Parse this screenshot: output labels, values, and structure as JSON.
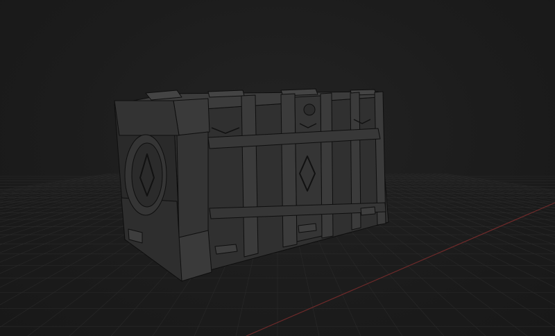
{
  "viewport": {
    "background": "#1c1c1c",
    "grid_color": "#2a2a2a",
    "axis_color": "#7a2a2a"
  },
  "scene": {
    "object": "crate-3d-model",
    "shading": "wireframe-on-shaded",
    "emblem_icon": "diamond-icon"
  }
}
